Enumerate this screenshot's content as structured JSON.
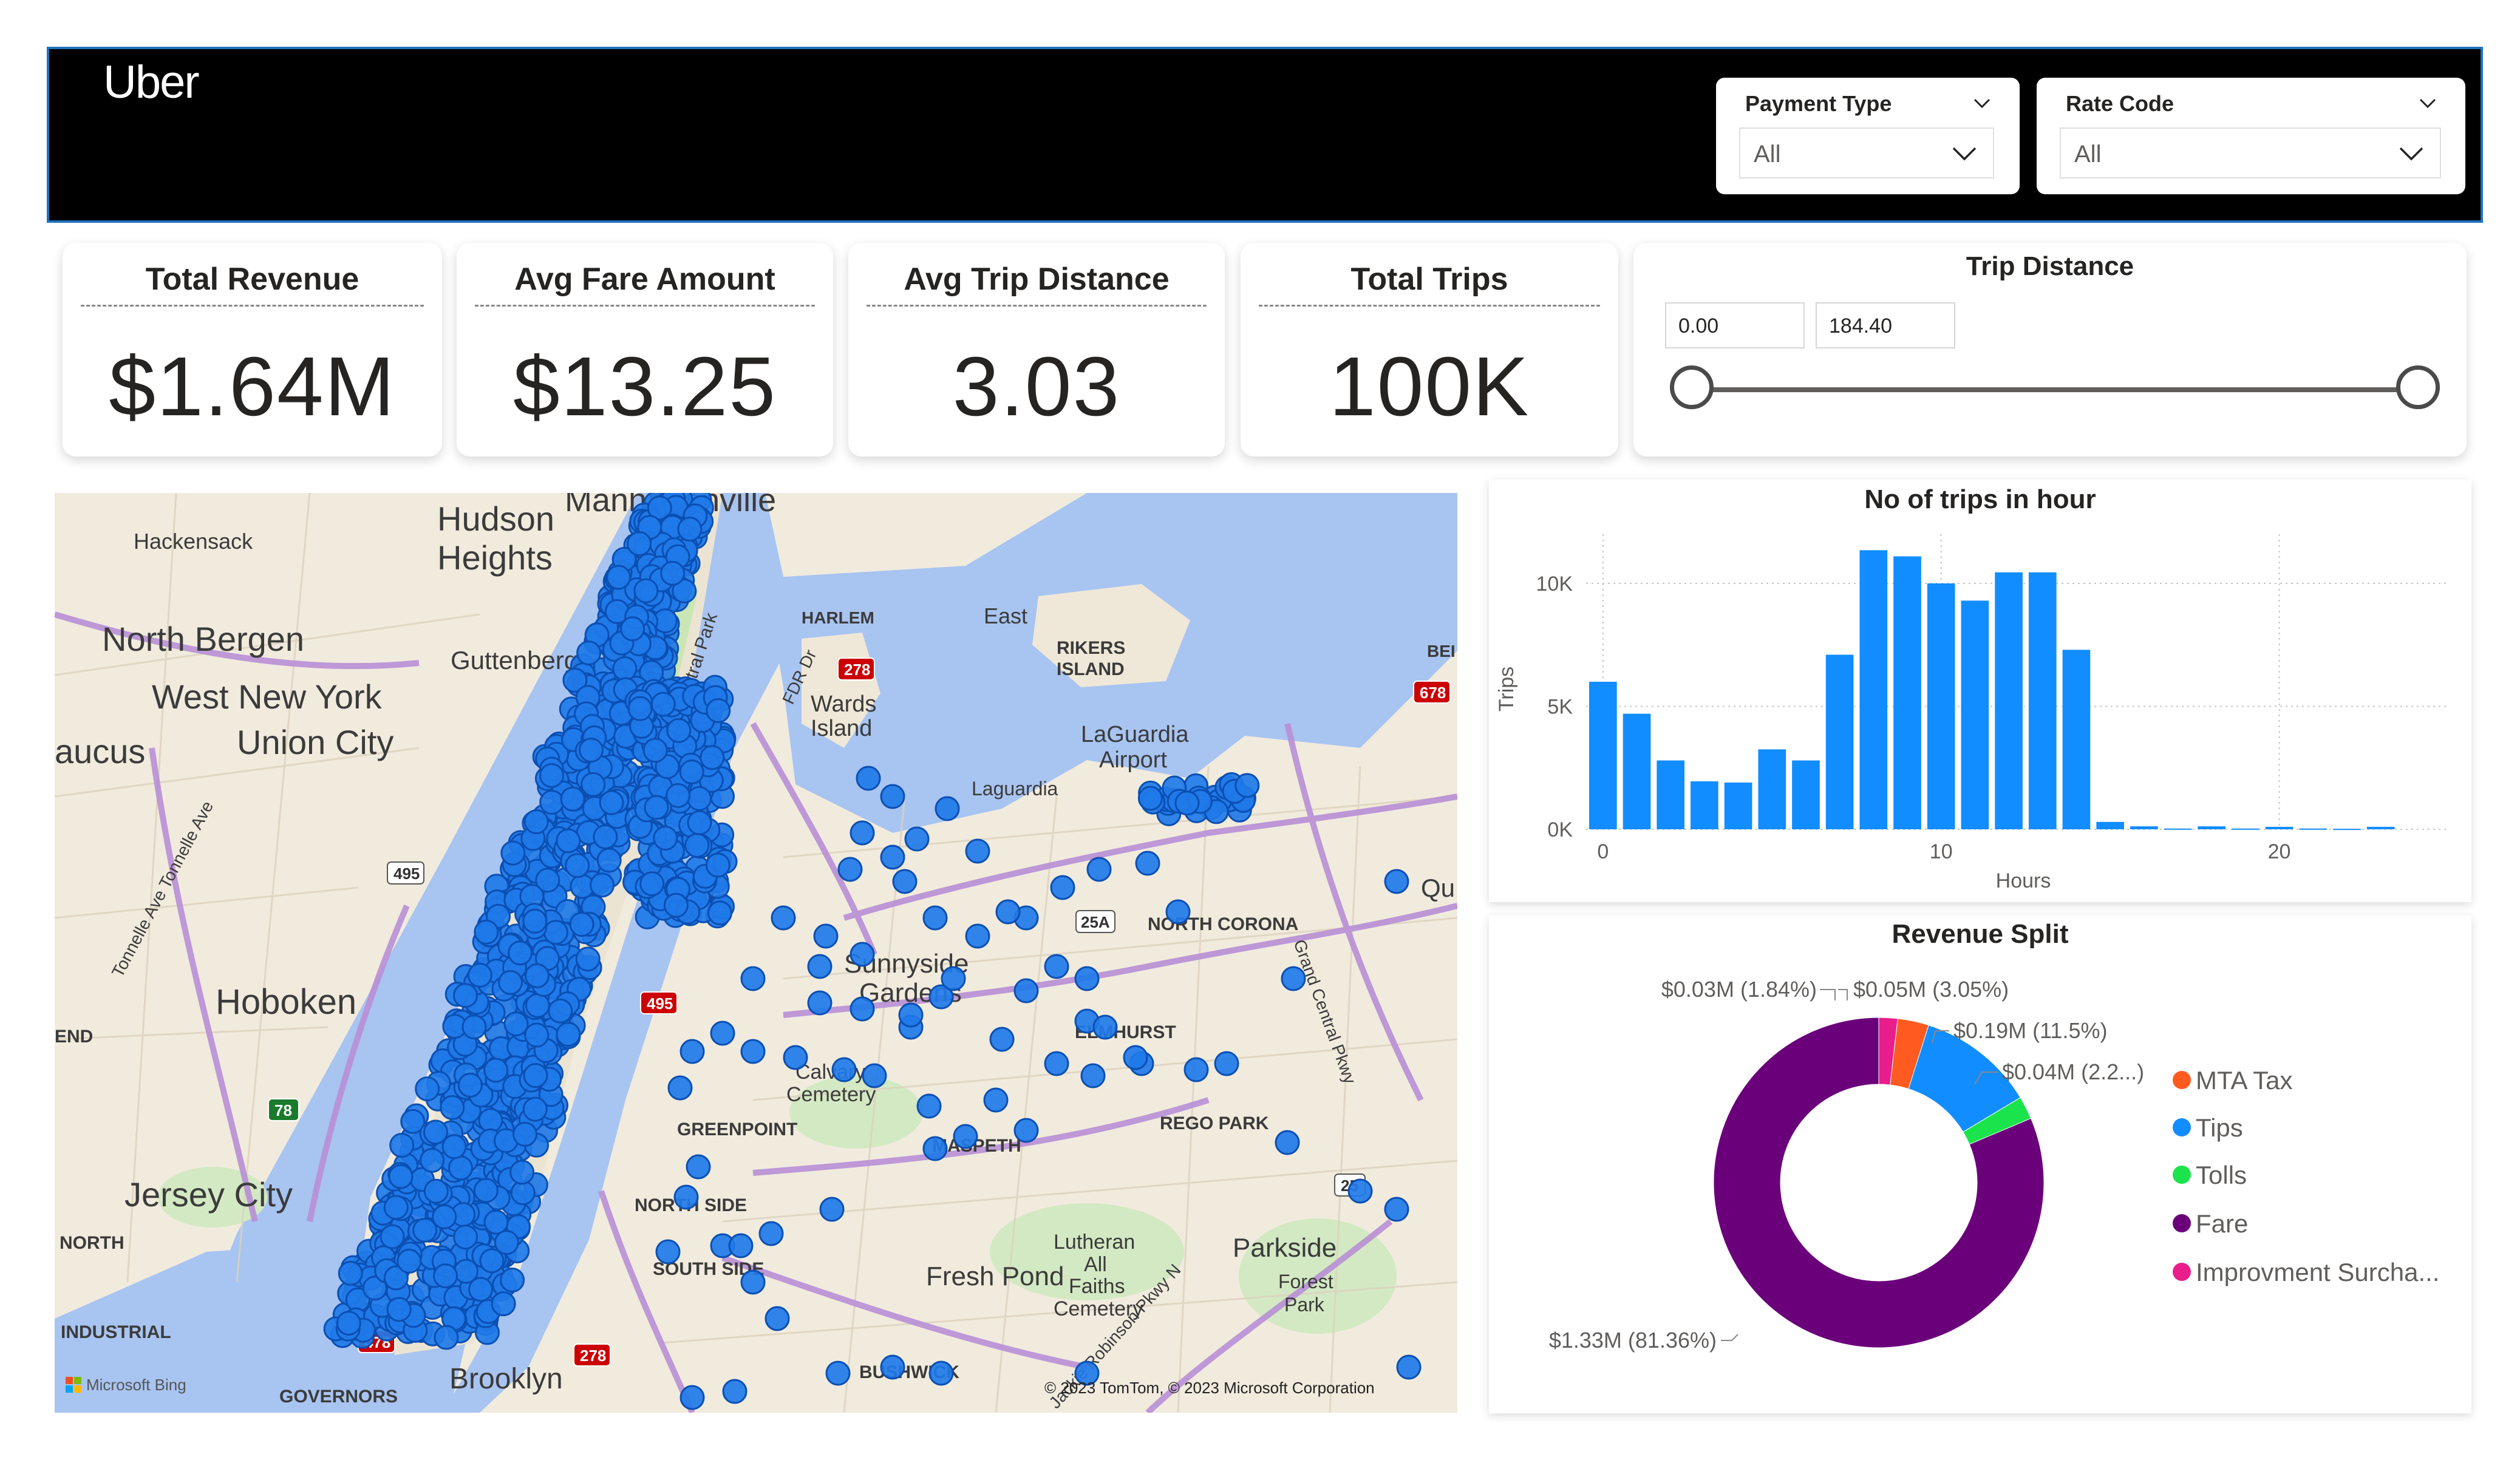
{
  "header": {
    "logo": "Uber",
    "payment_slicer": {
      "title": "Payment Type",
      "value": "All"
    },
    "rate_slicer": {
      "title": "Rate Code",
      "value": "All"
    }
  },
  "kpis": [
    {
      "title": "Total Revenue",
      "value": "$1.64M"
    },
    {
      "title": "Avg Fare Amount",
      "value": "$13.25"
    },
    {
      "title": "Avg Trip Distance",
      "value": "3.03"
    },
    {
      "title": "Total Trips",
      "value": "100K"
    }
  ],
  "trip_distance": {
    "title": "Trip Distance",
    "min": "0.00",
    "max": "184.40",
    "range_fraction": [
      0,
      1
    ]
  },
  "map": {
    "labels": {
      "manhattanville": "Manhattanville",
      "hudson": "Hudson",
      "heights": "Heights",
      "hackensack": "Hackensack",
      "north_bergen": "North Bergen",
      "guttenberg": "Guttenberg",
      "west_new_york": "West New York",
      "union_city": "Union City",
      "aucus": "aucus",
      "hoboken": "Hoboken",
      "jersey_city": "Jersey City",
      "east": "East",
      "rikers1": "RIKERS",
      "rikers2": "ISLAND",
      "wards1": "Wards",
      "wards2": "Island",
      "laguardia1": "LaGuardia",
      "laguardia2": "Airport",
      "laguardia_rd": "Laguardia",
      "york": "ork",
      "sunnyside": "Sunnyside",
      "gardens": "Gardens",
      "north_corona": "NORTH CORONA",
      "elmhurst": "ELMHURST",
      "rego_park": "REGO PARK",
      "maspeth": "MASPETH",
      "greenpoint": "GREENPOINT",
      "calvary1": "Calvary",
      "calvary2": "Cemetery",
      "fresh_pond": "Fresh Pond",
      "lutheran1": "Lutheran",
      "lutheran2": "All",
      "lutheran3": "Faiths",
      "lutheran4": "Cemetery",
      "parkside": "Parkside",
      "forest1": "Forest",
      "forest2": "Park",
      "north_side": "NORTH SIDE",
      "south_side": "SOUTH SIDE",
      "industrial": "INDUSTRIAL",
      "governors": "GOVERNORS",
      "brooklyn": "Brooklyn",
      "bushwick": "BUSHWICK",
      "end": "END",
      "north": "NORTH",
      "qu": "Qu",
      "bei": "BEI",
      "harlem": "HARLEM",
      "central_park": "Central Park",
      "fdr": "FDR Dr",
      "tonnelle": "Tonnelle Ave Tonnelle Ave",
      "grand_central": "Grand Central Pkwy",
      "jackie": "Jackie Robinson Pkwy N",
      "shield_495": "495",
      "shield_278": "278",
      "shield_678": "678",
      "shield_25a": "25A",
      "shield_78": "78",
      "shield_25": "25",
      "shield_478": "478"
    },
    "bing": "Microsoft Bing",
    "copyright": "© 2023 TomTom, © 2023 Microsoft Corporation"
  },
  "trips_chart": {
    "title": "No of trips in hour",
    "xlabel": "Hours",
    "ylabel": "Trips",
    "yticks": [
      "0K",
      "5K",
      "10K"
    ],
    "xticks": [
      "0",
      "10",
      "20"
    ],
    "color": "#118dff"
  },
  "chart_data": {
    "type": "bar",
    "title": "No of trips in hour",
    "xlabel": "Hours",
    "ylabel": "Trips",
    "x": [
      0,
      1,
      2,
      3,
      4,
      5,
      6,
      7,
      8,
      9,
      10,
      11,
      12,
      13,
      14,
      15,
      16,
      17,
      18,
      19,
      20,
      21,
      22,
      23
    ],
    "values": [
      6000,
      4700,
      2800,
      1950,
      1900,
      3250,
      2800,
      7100,
      11350,
      11100,
      10000,
      9300,
      10450,
      10450,
      7300,
      300,
      120,
      30,
      120,
      30,
      100,
      30,
      20,
      100
    ],
    "ylim": [
      0,
      12000
    ],
    "xlim": [
      -0.5,
      25
    ]
  },
  "revenue_split": {
    "title": "Revenue Split",
    "slices": [
      {
        "name": "Improvment Surcha...",
        "value": 1.84,
        "label": "$0.03M (1.84%)",
        "color": "#e91e8c"
      },
      {
        "name": "MTA Tax",
        "value": 3.05,
        "label": "$0.05M (3.05%)",
        "color": "#ff5a1f"
      },
      {
        "name": "Tips",
        "value": 11.5,
        "label": "$0.19M (11.5%)",
        "color": "#118dff"
      },
      {
        "name": "Tolls",
        "value": 2.25,
        "label": "$0.04M (2.2...)",
        "color": "#1be34b"
      },
      {
        "name": "Fare",
        "value": 81.36,
        "label": "$1.33M (81.36%)",
        "color": "#6b007b"
      }
    ],
    "legend": [
      {
        "name": "MTA Tax",
        "color": "#ff5a1f"
      },
      {
        "name": "Tips",
        "color": "#118dff"
      },
      {
        "name": "Tolls",
        "color": "#1be34b"
      },
      {
        "name": "Fare",
        "color": "#6b007b"
      },
      {
        "name": "Improvment Surcha...",
        "color": "#e91e8c"
      }
    ]
  }
}
